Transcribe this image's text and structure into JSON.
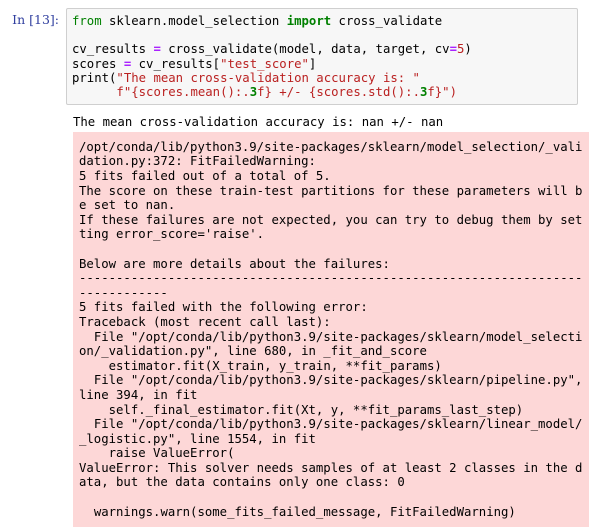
{
  "notebook": {
    "cell": {
      "prompt_label": "In [13]:",
      "execution_count": 13,
      "language": "python",
      "source_lines": [
        "from sklearn.model_selection import cross_validate",
        "",
        "cv_results = cross_validate(model, data, target, cv=5)",
        "scores = cv_results[\"test_score\"]",
        "print(\"The mean cross-validation accuracy is: \"",
        "      f\"{scores.mean():.3f} +/- {scores.std():.3f}\")"
      ],
      "tokens": {
        "kw_from": "from",
        "module_path": " sklearn.model_selection ",
        "kw_import": "import",
        "imported_name": " cross_validate",
        "var_cv_results": "cv_results ",
        "assign": "=",
        "call_cross_validate": " cross_validate(model, data, target, cv",
        "kwarg_assign": "=",
        "cv_value": "5",
        "close_paren": ")",
        "var_scores": "scores ",
        "index_expr": " cv_results[",
        "str_test_score": "\"test_score\"",
        "close_bracket": "]",
        "fn_print": "print(",
        "str_message": "\"The mean cross-validation accuracy is: \"",
        "indent": "      ",
        "fstr_open": "f\"{scores.mean():.",
        "fstr_prec1": "3",
        "fstr_mid": "f} +/- {scores.std():.",
        "fstr_prec2": "3",
        "fstr_close": "f}\")"
      }
    },
    "outputs": [
      {
        "type": "stdout",
        "name": "mean-accuracy-output",
        "text": "The mean cross-validation accuracy is: nan +/- nan"
      },
      {
        "type": "stderr",
        "name": "fit-failed-warning-output",
        "background": "#fdd7d7",
        "text": "/opt/conda/lib/python3.9/site-packages/sklearn/model_selection/_validation.py:372: FitFailedWarning:\n5 fits failed out of a total of 5.\nThe score on these train-test partitions for these parameters will be set to nan.\nIf these failures are not expected, you can try to debug them by setting error_score='raise'.\n\nBelow are more details about the failures:\n--------------------------------------------------------------------------------\n5 fits failed with the following error:\nTraceback (most recent call last):\n  File \"/opt/conda/lib/python3.9/site-packages/sklearn/model_selection/_validation.py\", line 680, in _fit_and_score\n    estimator.fit(X_train, y_train, **fit_params)\n  File \"/opt/conda/lib/python3.9/site-packages/sklearn/pipeline.py\", line 394, in fit\n    self._final_estimator.fit(Xt, y, **fit_params_last_step)\n  File \"/opt/conda/lib/python3.9/site-packages/sklearn/linear_model/_logistic.py\", line 1554, in fit\n    raise ValueError(\nValueError: This solver needs samples of at least 2 classes in the data, but the data contains only one class: 0\n\n  warnings.warn(some_fits_failed_message, FitFailedWarning)",
        "details": {
          "warning_file": "/opt/conda/lib/python3.9/site-packages/sklearn/model_selection/_validation.py",
          "warning_line": 372,
          "warning_class": "FitFailedWarning",
          "fits_failed": 5,
          "fits_total": 5,
          "error_class": "ValueError",
          "error_message": "This solver needs samples of at least 2 classes in the data, but the data contains only one class: 0",
          "traceback_frames": [
            {
              "file": "/opt/conda/lib/python3.9/site-packages/sklearn/model_selection/_validation.py",
              "line": 680,
              "func": "_fit_and_score",
              "code": "estimator.fit(X_train, y_train, **fit_params)"
            },
            {
              "file": "/opt/conda/lib/python3.9/site-packages/sklearn/pipeline.py",
              "line": 394,
              "func": "fit",
              "code": "self._final_estimator.fit(Xt, y, **fit_params_last_step)"
            },
            {
              "file": "/opt/conda/lib/python3.9/site-packages/sklearn/linear_model/_logistic.py",
              "line": 1554,
              "func": "fit",
              "code": "raise ValueError("
            }
          ],
          "final_line": "  warnings.warn(some_fits_failed_message, FitFailedWarning)"
        }
      }
    ]
  },
  "colors": {
    "prompt": "#303f9f",
    "code_background": "#f7f7f7",
    "code_border": "#cfcfcf",
    "stderr_background": "#fdd7d7",
    "keyword": "#008000",
    "string": "#ba2121",
    "operator": "#aa22ff",
    "text": "#000000"
  }
}
